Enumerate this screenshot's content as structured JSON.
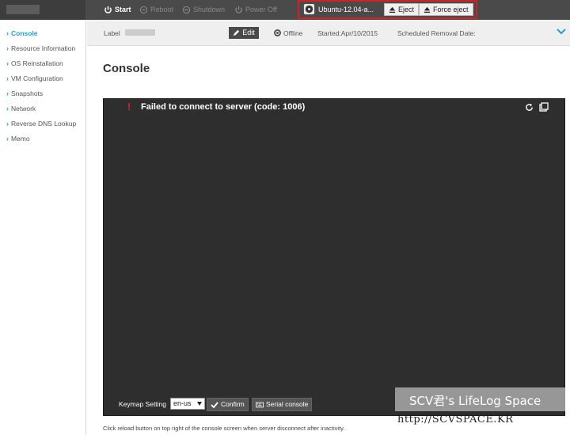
{
  "topbar": {
    "logo_alt": "",
    "start_label": "Start",
    "reboot_label": "Reboot",
    "shutdown_label": "Shutdown",
    "poweroff_label": "Power Off",
    "iso_name": "Ubuntu-12.04-a...",
    "eject_label": "Eject",
    "force_eject_label": "Force eject",
    "highlight_color": "#d32020"
  },
  "sidebar": {
    "items": [
      {
        "label": "Console",
        "active": true
      },
      {
        "label": "Resource Information",
        "active": false
      },
      {
        "label": "OS Reinstallation",
        "active": false
      },
      {
        "label": "VM Configuration",
        "active": false
      },
      {
        "label": "Snapshots",
        "active": false
      },
      {
        "label": "Network",
        "active": false
      },
      {
        "label": "Reverse DNS Lookup",
        "active": false
      },
      {
        "label": "Memo",
        "active": false
      }
    ],
    "accent_color": "#1a9fd8"
  },
  "infobar": {
    "label_caption": "Label",
    "edit_label": "Edit",
    "status": "Offline",
    "started": "Started:Apr/10/2015",
    "scheduled_removal": "Scheduled Removal Date:"
  },
  "main": {
    "title": "Console",
    "error_icon": "!",
    "error_message": "Failed to connect to server (code: 1006)",
    "keymap_label": "Keymap Setting",
    "keymap_value": "en-us",
    "confirm_label": "Confirm",
    "serial_console_label": "Serial console",
    "footnote": "Click reload button on top right of the console screen when server disconnect after inactivity."
  },
  "watermark": {
    "line1": "SCV君's LifeLog Space",
    "line2": "http://SCVSPACE.KR"
  }
}
